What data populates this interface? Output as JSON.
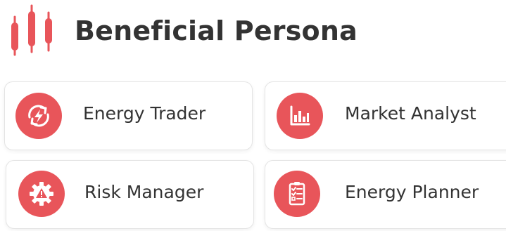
{
  "header": {
    "title": "Beneficial Persona",
    "logo_icon": "candlestick-chart-icon"
  },
  "colors": {
    "accent": "#e8555a",
    "text": "#333333",
    "card_border": "#e4e4e4",
    "background": "#ffffff"
  },
  "personas": [
    {
      "label": "Energy Trader",
      "icon": "energy-exchange-icon"
    },
    {
      "label": "Market Analyst",
      "icon": "bar-chart-icon"
    },
    {
      "label": "Risk Manager",
      "icon": "gear-warning-icon"
    },
    {
      "label": "Energy Planner",
      "icon": "checklist-icon"
    }
  ]
}
